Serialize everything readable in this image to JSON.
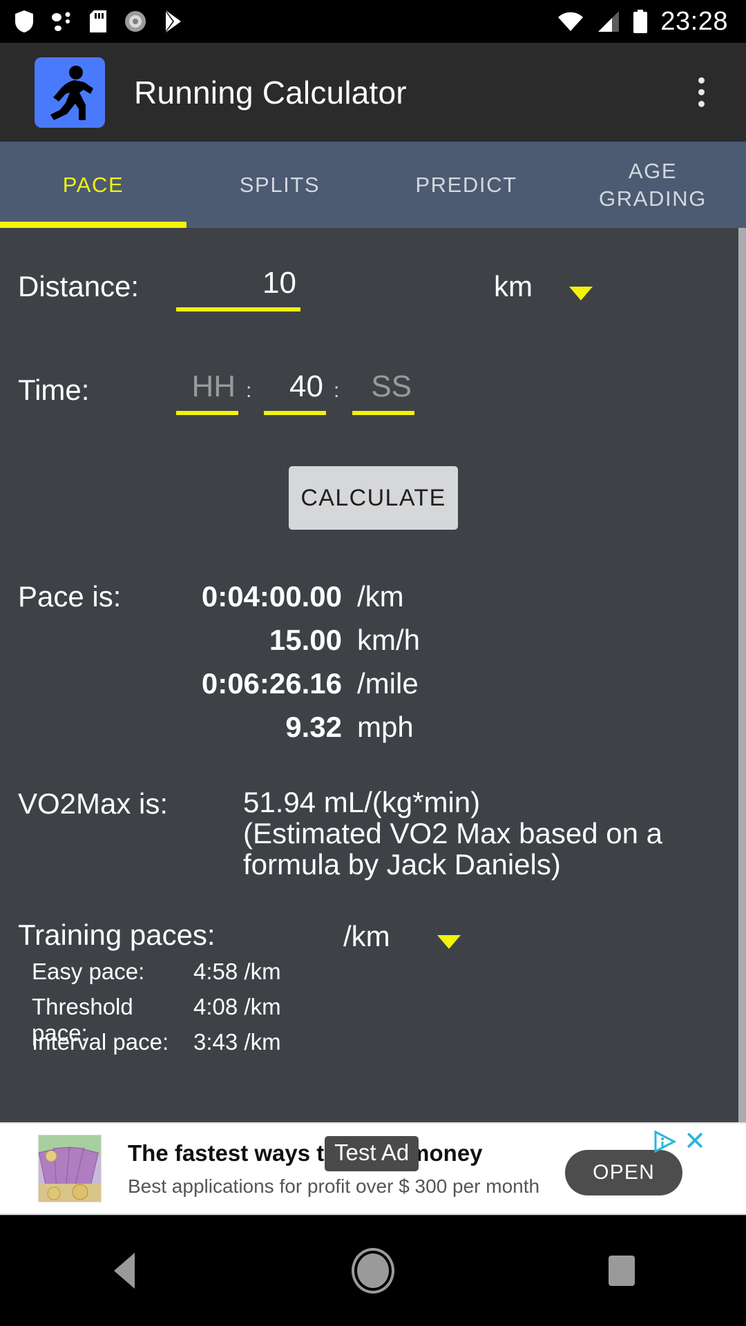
{
  "status_bar": {
    "time": "23:28",
    "icons": [
      "shield-icon",
      "bluetooth-share-icon",
      "sd-card-icon",
      "settings-gear-icon",
      "play-store-icon"
    ],
    "right_icons": [
      "wifi-icon",
      "cellular-signal-icon",
      "battery-icon"
    ]
  },
  "app_bar": {
    "title": "Running Calculator",
    "icon": "running-person-icon",
    "icon_bg": "#4a7afc",
    "overflow": "overflow-menu-icon"
  },
  "tabs": {
    "active_index": 0,
    "accent": "#f2f20d",
    "items": [
      {
        "label": "PACE"
      },
      {
        "label": "SPLITS"
      },
      {
        "label": "PREDICT"
      },
      {
        "label": "AGE\nGRADING"
      }
    ]
  },
  "form": {
    "distance_label": "Distance:",
    "distance_value": "10",
    "distance_unit": "km",
    "time_label": "Time:",
    "time_hh_placeholder": "HH",
    "time_hh_value": "",
    "time_mm_value": "40",
    "time_ss_placeholder": "SS",
    "time_ss_value": "",
    "separator": ":",
    "calculate_label": "CALCULATE"
  },
  "results": {
    "pace_label": "Pace is:",
    "pace_rows": [
      {
        "value": "0:04:00.00",
        "unit": "/km"
      },
      {
        "value": "15.00",
        "unit": "km/h"
      },
      {
        "value": "0:06:26.16",
        "unit": "/mile"
      },
      {
        "value": "9.32",
        "unit": "mph"
      }
    ],
    "vo2_label": "VO2Max is:",
    "vo2_value": "51.94 mL/(kg*min)",
    "vo2_note": "(Estimated VO2 Max based on a formula by Jack Daniels)",
    "training_label": "Training paces:",
    "training_unit": "/km",
    "training_rows": [
      {
        "name": "Easy pace:",
        "value": "4:58 /km"
      },
      {
        "name": "Threshold pace:",
        "value": "4:08 /km"
      },
      {
        "name": "Interval pace:",
        "value": "3:43 /km"
      }
    ]
  },
  "ad": {
    "badge": "Test Ad",
    "headline": "The fastest ways to make money",
    "subtitle": "Best applications for profit over $ 300 per month",
    "cta": "OPEN",
    "close": "✕",
    "thumb": "euro-banknotes-image",
    "adchoices": "adchoices-icon"
  },
  "nav_bar": {
    "back": "back-triangle-icon",
    "home": "home-circle-icon",
    "recents": "recents-square-icon"
  }
}
